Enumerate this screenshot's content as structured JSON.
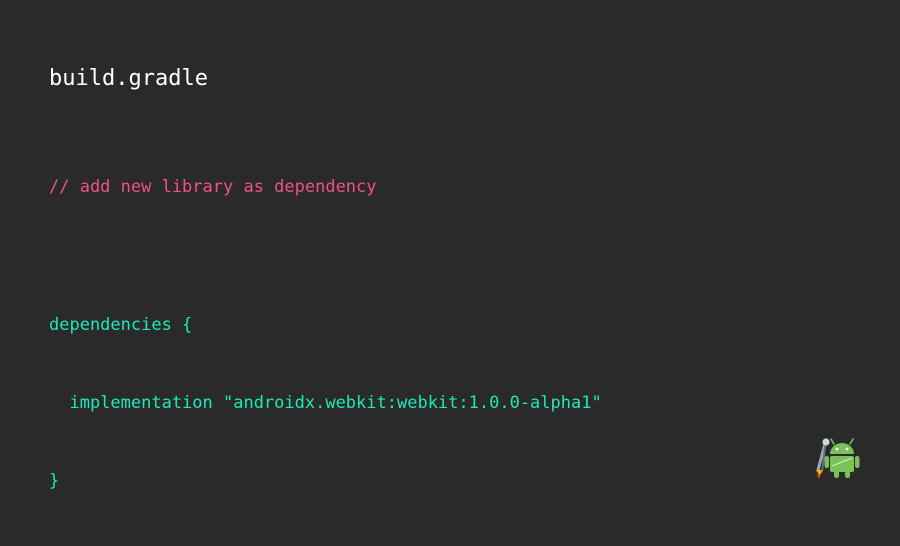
{
  "slide": {
    "title": "build.gradle",
    "code": {
      "comment": "// add new library as dependency",
      "line1": "dependencies {",
      "line2": "  implementation \"androidx.webkit:webkit:1.0.0-alpha1\"",
      "line3": "}"
    },
    "logo_icon": "android-studio-logo-icon",
    "colors": {
      "background": "#2a2a2a",
      "title": "#ffffff",
      "comment": "#f0508c",
      "code": "#1de9b6"
    }
  }
}
